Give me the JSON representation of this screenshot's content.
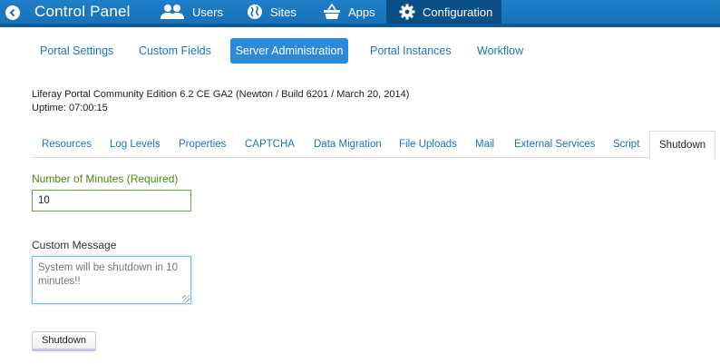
{
  "topbar": {
    "title": "Control Panel",
    "items": [
      {
        "label": "Users",
        "icon": "users-icon"
      },
      {
        "label": "Sites",
        "icon": "globe-icon"
      },
      {
        "label": "Apps",
        "icon": "basket-icon"
      },
      {
        "label": "Configuration",
        "icon": "gear-icon",
        "active": true
      }
    ],
    "colors": {
      "bar": "#1f7fc8",
      "active": "#0a4f86"
    }
  },
  "subtabs": [
    {
      "label": "Portal Settings"
    },
    {
      "label": "Custom Fields"
    },
    {
      "label": "Server Administration",
      "active": true
    },
    {
      "label": "Portal Instances"
    },
    {
      "label": "Workflow"
    }
  ],
  "info": {
    "version": "Liferay Portal Community Edition 6.2 CE GA2 (Newton / Build 6201 / March 20, 2014)",
    "uptime": "Uptime: 07:00:15"
  },
  "tabs": [
    {
      "label": "Resources"
    },
    {
      "label": "Log Levels"
    },
    {
      "label": "Properties"
    },
    {
      "label": "CAPTCHA"
    },
    {
      "label": "Data Migration"
    },
    {
      "label": "File Uploads"
    },
    {
      "label": "Mail"
    },
    {
      "label": "External Services"
    },
    {
      "label": "Script"
    },
    {
      "label": "Shutdown",
      "active": true
    }
  ],
  "form": {
    "minutes_label": "Number of Minutes (Required)",
    "minutes_value": "10",
    "message_label": "Custom Message",
    "message_placeholder": "System will be shutdown in 10 minutes!!",
    "submit_label": "Shutdown"
  }
}
